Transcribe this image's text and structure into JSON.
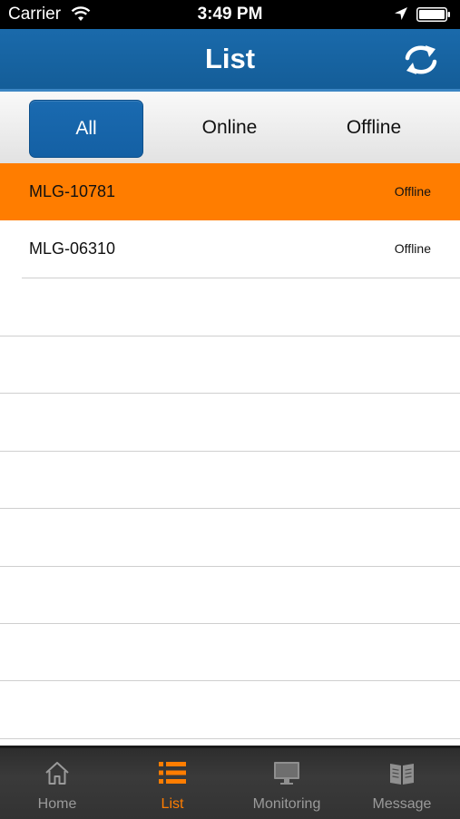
{
  "status_bar": {
    "carrier": "Carrier",
    "time": "3:49 PM"
  },
  "nav": {
    "title": "List",
    "refresh_icon": "refresh-icon"
  },
  "filters": {
    "selected": "All",
    "items": [
      "All",
      "Online",
      "Offline"
    ]
  },
  "devices": [
    {
      "name": "MLG-10781",
      "status": "Offline",
      "selected": true
    },
    {
      "name": "MLG-06310",
      "status": "Offline",
      "selected": false
    }
  ],
  "tabs": {
    "active": "List",
    "items": [
      {
        "label": "Home",
        "icon": "home-icon"
      },
      {
        "label": "List",
        "icon": "list-icon"
      },
      {
        "label": "Monitoring",
        "icon": "monitor-icon"
      },
      {
        "label": "Message",
        "icon": "message-icon"
      }
    ]
  },
  "colors": {
    "nav_blue": "#1a6aab",
    "highlight_orange": "#ff7d00",
    "tab_bar_dark": "#333333"
  }
}
